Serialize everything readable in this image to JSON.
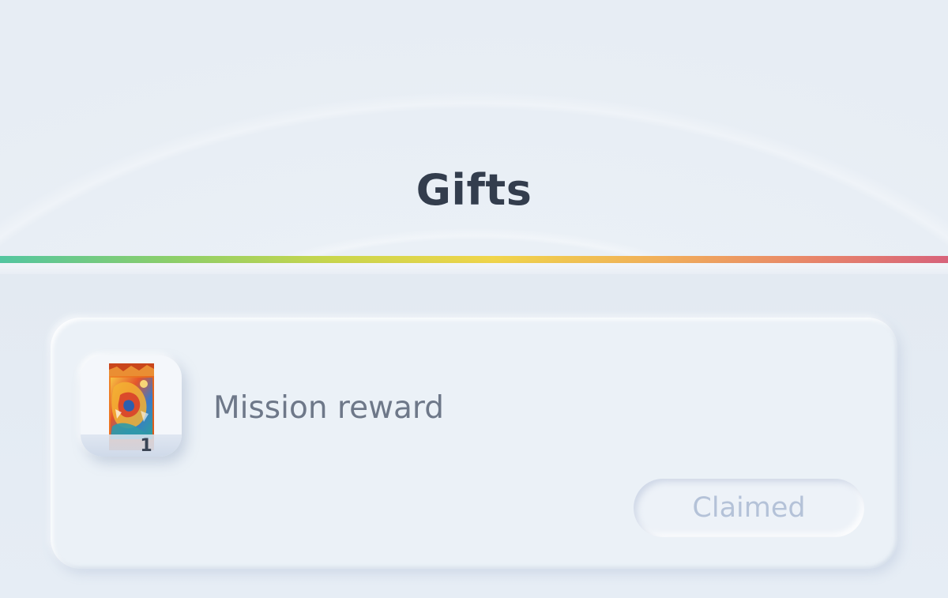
{
  "header": {
    "title": "Gifts"
  },
  "gifts": [
    {
      "label": "Mission reward",
      "quantity": "1",
      "icon": "booster-pack-icon",
      "status": "Claimed"
    }
  ],
  "colors": {
    "title": "#333d4d",
    "label": "#6e7889",
    "status_text": "#b4c2d8",
    "rainbow": [
      "#53c6a0",
      "#c9d64c",
      "#f0d54a",
      "#f1ae5a",
      "#d8637a"
    ]
  }
}
